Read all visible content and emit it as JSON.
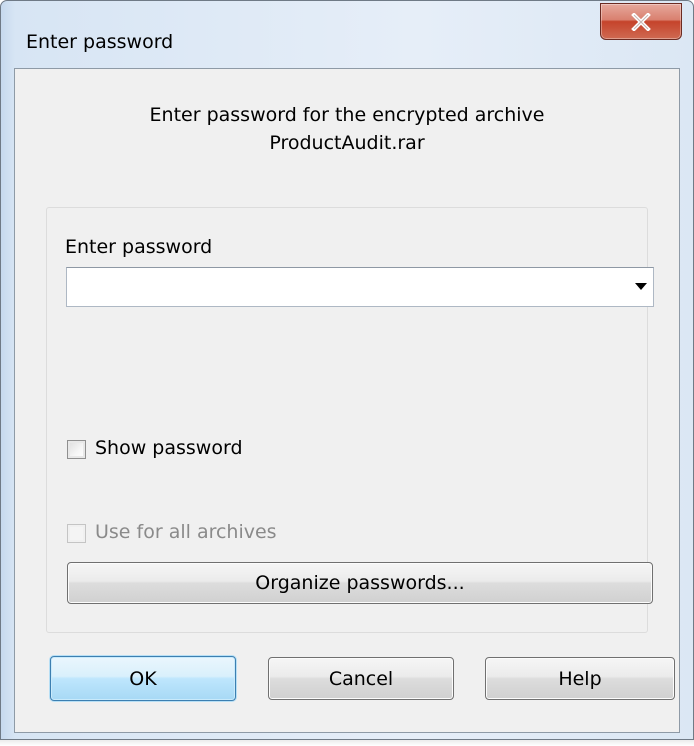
{
  "window": {
    "title": "Enter password",
    "close_symbol": "X"
  },
  "header": {
    "line1": "Enter password for the encrypted archive",
    "line2": "ProductAudit.rar"
  },
  "password": {
    "label": "Enter password",
    "value": ""
  },
  "options": {
    "show_password_label": "Show password",
    "show_password_checked": false,
    "use_for_all_label": "Use for all archives",
    "use_for_all_checked": false,
    "use_for_all_enabled": false,
    "organize_label": "Organize passwords..."
  },
  "buttons": {
    "ok": "OK",
    "cancel": "Cancel",
    "help": "Help"
  },
  "icons": [
    "close-icon",
    "dropdown-arrow-icon",
    "checkbox-icon"
  ]
}
